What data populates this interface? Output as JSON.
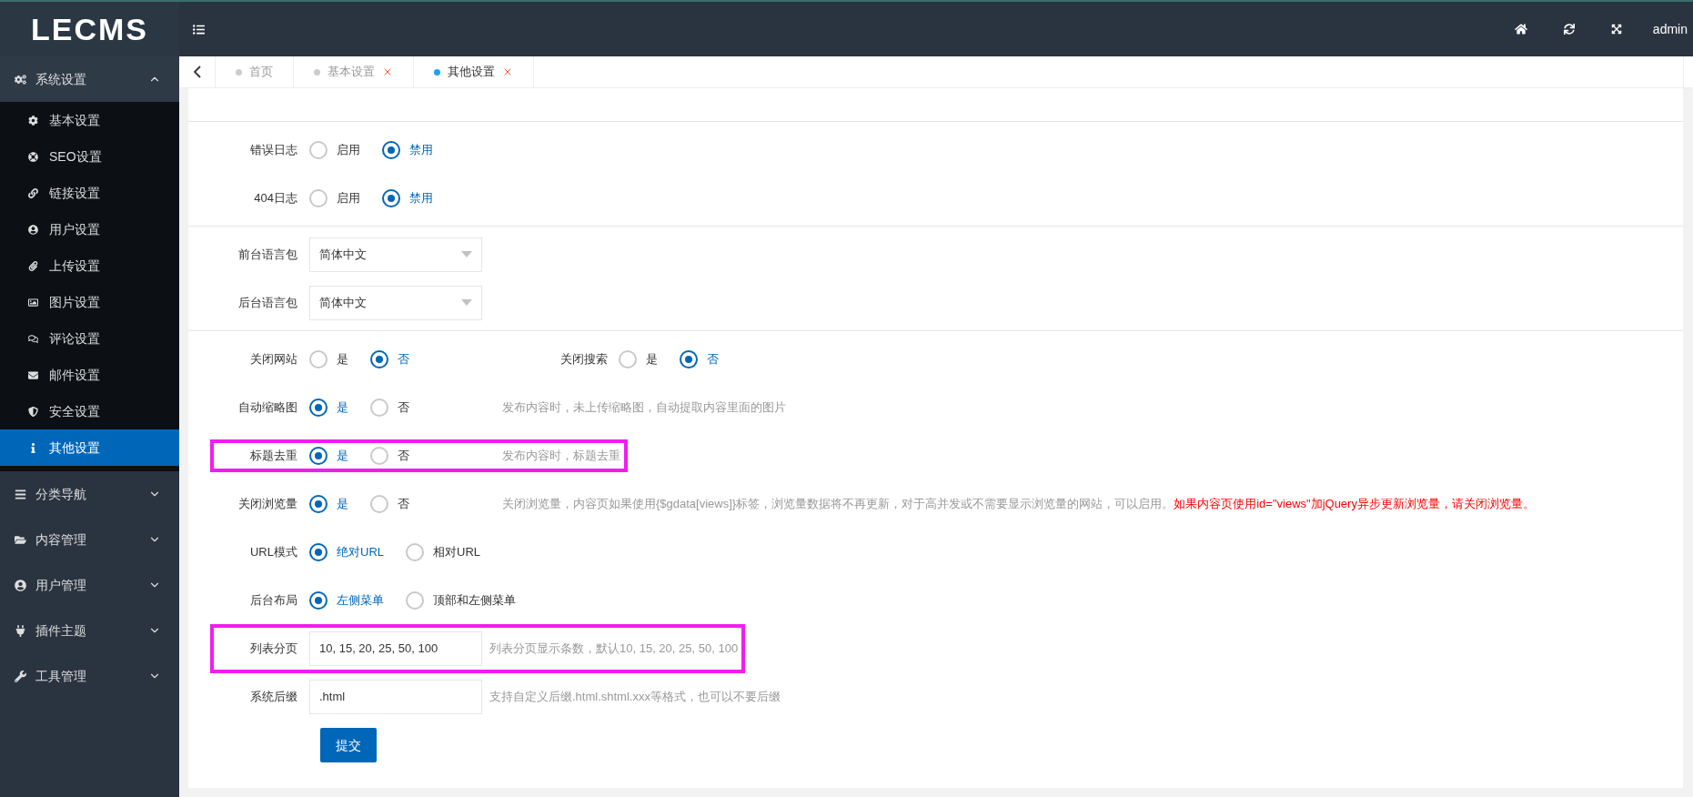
{
  "topbar": {
    "logo": "LECMS",
    "user": "admin"
  },
  "sidebar": {
    "groups": [
      {
        "label": "系统设置",
        "expanded": true,
        "items": [
          {
            "label": "基本设置",
            "selected": false
          },
          {
            "label": "SEO设置",
            "selected": false
          },
          {
            "label": "链接设置",
            "selected": false
          },
          {
            "label": "用户设置",
            "selected": false
          },
          {
            "label": "上传设置",
            "selected": false
          },
          {
            "label": "图片设置",
            "selected": false
          },
          {
            "label": "评论设置",
            "selected": false
          },
          {
            "label": "邮件设置",
            "selected": false
          },
          {
            "label": "安全设置",
            "selected": false
          },
          {
            "label": "其他设置",
            "selected": true
          }
        ]
      },
      {
        "label": "分类导航",
        "expanded": false
      },
      {
        "label": "内容管理",
        "expanded": false
      },
      {
        "label": "用户管理",
        "expanded": false
      },
      {
        "label": "插件主题",
        "expanded": false
      },
      {
        "label": "工具管理",
        "expanded": false
      }
    ]
  },
  "tabs": [
    {
      "label": "首页",
      "selected": false,
      "closable": false
    },
    {
      "label": "基本设置",
      "selected": false,
      "closable": true
    },
    {
      "label": "其他设置",
      "selected": true,
      "closable": true
    }
  ],
  "sections": [
    {
      "rows": [
        {
          "kind": "radio",
          "label": "错误日志",
          "highlighted": false,
          "options": [
            {
              "label": "启用",
              "selected": false
            },
            {
              "label": "禁用",
              "selected": true
            }
          ]
        },
        {
          "kind": "radio",
          "label": "404日志",
          "highlighted": false,
          "options": [
            {
              "label": "启用",
              "selected": false
            },
            {
              "label": "禁用",
              "selected": true
            }
          ]
        }
      ]
    },
    {
      "rows": [
        {
          "kind": "select",
          "label": "前台语言包",
          "highlighted": false,
          "value": "简体中文"
        },
        {
          "kind": "select",
          "label": "后台语言包",
          "highlighted": false,
          "value": "简体中文"
        }
      ]
    },
    {
      "rows": [
        {
          "kind": "radio",
          "label": "关闭网站",
          "highlighted": false,
          "options": [
            {
              "label": "是",
              "selected": false
            },
            {
              "label": "否",
              "selected": true
            }
          ],
          "extra": {
            "label": "关闭搜索",
            "options": [
              {
                "label": "是",
                "selected": false
              },
              {
                "label": "否",
                "selected": true
              }
            ]
          }
        },
        {
          "kind": "radio",
          "label": "自动缩略图",
          "highlighted": false,
          "options": [
            {
              "label": "是",
              "selected": true
            },
            {
              "label": "否",
              "selected": false
            }
          ],
          "help": "发布内容时，未上传缩略图，自动提取内容里面的图片"
        },
        {
          "kind": "radio",
          "label": "标题去重",
          "highlighted": true,
          "options": [
            {
              "label": "是",
              "selected": true
            },
            {
              "label": "否",
              "selected": false
            }
          ],
          "help": "发布内容时，标题去重"
        },
        {
          "kind": "radio",
          "label": "关闭浏览量",
          "highlighted": false,
          "options": [
            {
              "label": "是",
              "selected": true
            },
            {
              "label": "否",
              "selected": false
            }
          ],
          "help": "关闭浏览量，内容页如果使用{$gdata[views]}标签，浏览量数据将不再更新，对于高并发或不需要显示浏览量的网站，可以启用。",
          "warning": "如果内容页使用id=\"views\"加jQuery异步更新浏览量，请关闭浏览量。"
        },
        {
          "kind": "radio",
          "label": "URL模式",
          "highlighted": false,
          "options": [
            {
              "label": "绝对URL",
              "selected": true
            },
            {
              "label": "相对URL",
              "selected": false
            }
          ]
        },
        {
          "kind": "radio",
          "label": "后台布局",
          "highlighted": false,
          "options": [
            {
              "label": "左侧菜单",
              "selected": true
            },
            {
              "label": "顶部和左侧菜单",
              "selected": false
            }
          ]
        },
        {
          "kind": "input",
          "label": "列表分页",
          "highlighted": true,
          "value": "10, 15, 20, 25, 50, 100",
          "help": "列表分页显示条数，默认10, 15, 20, 25, 50, 100"
        },
        {
          "kind": "input",
          "label": "系统后缀",
          "highlighted": false,
          "value": ".html",
          "help": "支持自定义后缀.html.shtml.xxx等格式，也可以不要后缀"
        }
      ]
    }
  ],
  "submit": "提交"
}
